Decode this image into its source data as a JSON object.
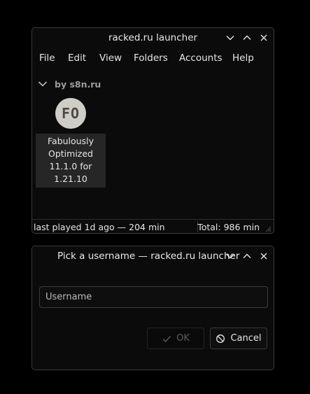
{
  "main_window": {
    "title": "racked.ru launcher",
    "menu": [
      "File",
      "Edit",
      "View",
      "Folders",
      "Accounts",
      "Help"
    ],
    "group": {
      "label": "by s8n.ru"
    },
    "instance": {
      "icon_text": "FO",
      "name_lines": [
        "Fabulously",
        "Optimized",
        "11.1.0 for",
        "1.21.10"
      ]
    },
    "status": {
      "left": "last played 1d ago — 204 min",
      "right": "Total: 986 min"
    }
  },
  "dialog": {
    "title": "Pick a username — racked.ru launcher",
    "username": {
      "placeholder": "Username",
      "value": ""
    },
    "ok_label": "OK",
    "cancel_label": "Cancel"
  },
  "colors": {
    "background": "#000000",
    "window": "#0b0b0b",
    "text": "#e6e6e6",
    "disabled_text": "#5b5b5b",
    "instance_highlight": "#262626"
  }
}
